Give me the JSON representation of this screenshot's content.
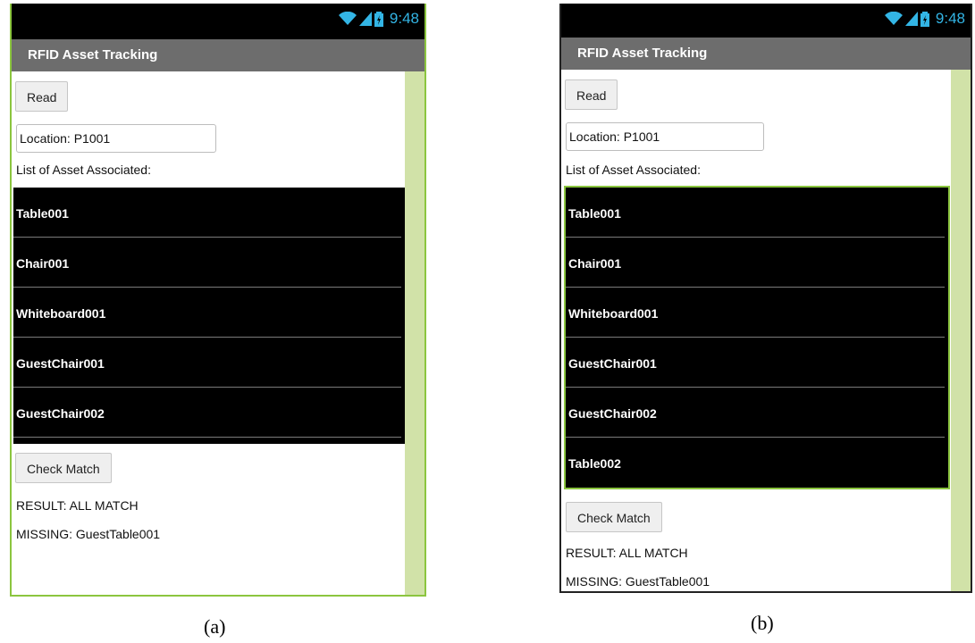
{
  "screens": [
    {
      "status_time": "9:48",
      "status_icons": [
        "wifi-icon",
        "signal-icon",
        "battery-charging-icon"
      ],
      "title": "RFID Asset Tracking",
      "read_button": "Read",
      "location_value": "Location: P1001",
      "list_label": "List of Asset Associated:",
      "assets": [
        "Table001",
        "Chair001",
        "Whiteboard001",
        "GuestChair001",
        "GuestChair002"
      ],
      "check_button": "Check Match",
      "result_text": "RESULT: ALL MATCH",
      "missing_text": "MISSING: GuestTable001",
      "caption": "(a)"
    },
    {
      "status_time": "9:48",
      "status_icons": [
        "wifi-icon",
        "signal-icon",
        "battery-charging-icon"
      ],
      "title": "RFID Asset Tracking",
      "read_button": "Read",
      "location_value": "Location: P1001",
      "list_label": "List of Asset Associated:",
      "assets": [
        "Table001",
        "Chair001",
        "Whiteboard001",
        "GuestChair001",
        "GuestChair002",
        "Table002"
      ],
      "check_button": "Check Match",
      "result_text": "RESULT: ALL MATCH",
      "missing_text": "MISSING: GuestTable001",
      "caption": "(b)"
    }
  ],
  "colors": {
    "status_bar": "#000000",
    "status_accent": "#33b5e5",
    "title_bar": "#6d6d6d",
    "frame_a": "#8bc53f",
    "frame_b": "#222222",
    "scroll_track": "#d1e2a8",
    "list_background": "#000000"
  }
}
